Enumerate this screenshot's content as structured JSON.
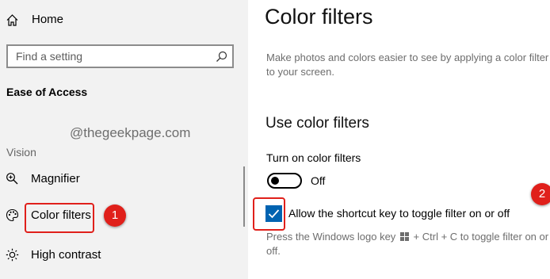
{
  "sidebar": {
    "home_label": "Home",
    "search_placeholder": "Find a setting",
    "section_title": "Ease of Access",
    "watermark": "@thegeekpage.com",
    "group_label": "Vision",
    "items": [
      {
        "label": "Magnifier",
        "icon": "magnifier-icon"
      },
      {
        "label": "Color filters",
        "icon": "palette-icon"
      },
      {
        "label": "High contrast",
        "icon": "sun-icon"
      }
    ]
  },
  "annotations": {
    "badge_1": "1",
    "badge_2": "2",
    "color": "#e0201b"
  },
  "main": {
    "title": "Color filters",
    "description": "Make photos and colors easier to see by applying a color filter to your screen.",
    "subheading": "Use color filters",
    "toggle_label": "Turn on color filters",
    "toggle_state": "Off",
    "shortcut_checkbox_label": "Allow the shortcut key to toggle filter on or off",
    "shortcut_checked": true,
    "help_prefix": "Press the Windows logo key",
    "help_suffix": "+ Ctrl + C to toggle filter on or off."
  },
  "colors": {
    "accent": "#0063b1",
    "sidebar_bg": "#f2f2f2",
    "annotation_red": "#e0201b"
  }
}
